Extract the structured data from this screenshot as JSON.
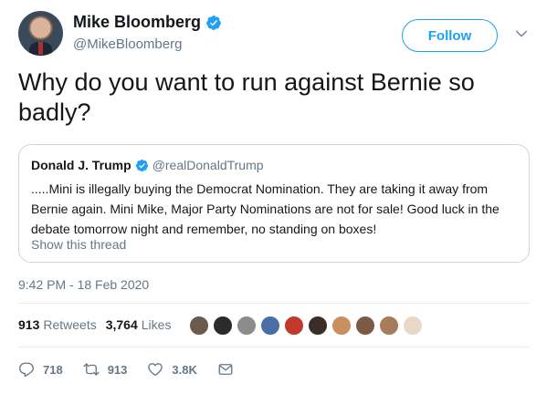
{
  "author": {
    "display_name": "Mike Bloomberg",
    "handle": "@MikeBloomberg",
    "verified": true
  },
  "follow_button": {
    "label": "Follow"
  },
  "tweet": {
    "text": "Why do you want to run against Bernie so badly?",
    "timestamp": "9:42 PM - 18 Feb 2020"
  },
  "quoted_tweet": {
    "display_name": "Donald J. Trump",
    "handle": "@realDonaldTrump",
    "verified": true,
    "text": ".....Mini is illegally buying the Democrat Nomination. They are taking it away from Bernie again. Mini Mike, Major Party Nominations are not for sale! Good luck in the debate tomorrow night and remember, no standing on boxes!",
    "show_thread": "Show this thread"
  },
  "stats": {
    "retweets_count": "913",
    "retweets_label": "Retweets",
    "likes_count": "3,764",
    "likes_label": "Likes"
  },
  "facepile_colors": [
    "#6b5a4e",
    "#2b2b2b",
    "#8c8c8c",
    "#4a6fa5",
    "#c0392b",
    "#3a2e28",
    "#c98f5e",
    "#7d5a45",
    "#a67c5b",
    "#e8d8c8"
  ],
  "actions": {
    "reply_count": "718",
    "retweet_count": "913",
    "like_count": "3.8K"
  },
  "colors": {
    "accent": "#1da1f2",
    "secondary_text": "#657786",
    "border": "#ccd6dd"
  }
}
